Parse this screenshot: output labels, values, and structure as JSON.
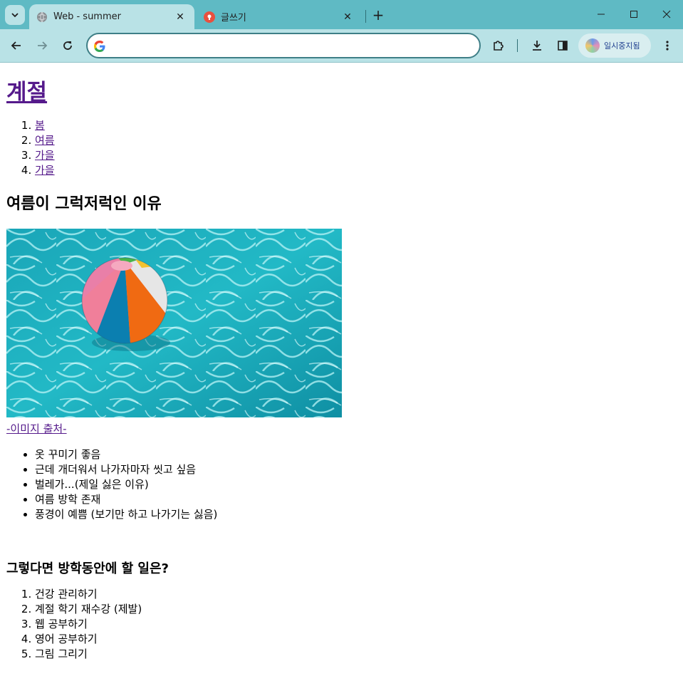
{
  "browser": {
    "tabs": [
      {
        "title": "Web - summer",
        "active": true,
        "favicon": "globe-icon"
      },
      {
        "title": "글쓰기",
        "active": false,
        "favicon": "blog-icon"
      }
    ],
    "address_bar": {
      "value": "",
      "placeholder": ""
    },
    "profile_label": "일시중지됨",
    "colors": {
      "frame": "#5fbac4",
      "toolbar": "#b9e2e6",
      "link_visited": "#551a8b"
    }
  },
  "page": {
    "site_title": "계절",
    "nav": [
      "봄",
      "여름",
      "가을",
      "가을"
    ],
    "heading": "여름이 그럭저럭인 이유",
    "image_credit": "-이미지 출처-",
    "reasons": [
      "옷 꾸미기 좋음",
      "근데 개더워서 나가자마자 씻고 싶음",
      "벌레가...(제일 싫은 이유)",
      "여름 방학 존재",
      "풍경이 예쁨 (보기만 하고 나가기는 싫음)"
    ],
    "subheading": "그렇다면 방학동안에 할 일은?",
    "plans": [
      "건강 관리하기",
      "계절 학기 재수강 (제발)",
      "웹 공부하기",
      "영어 공부하기",
      "그림 그리기"
    ]
  }
}
